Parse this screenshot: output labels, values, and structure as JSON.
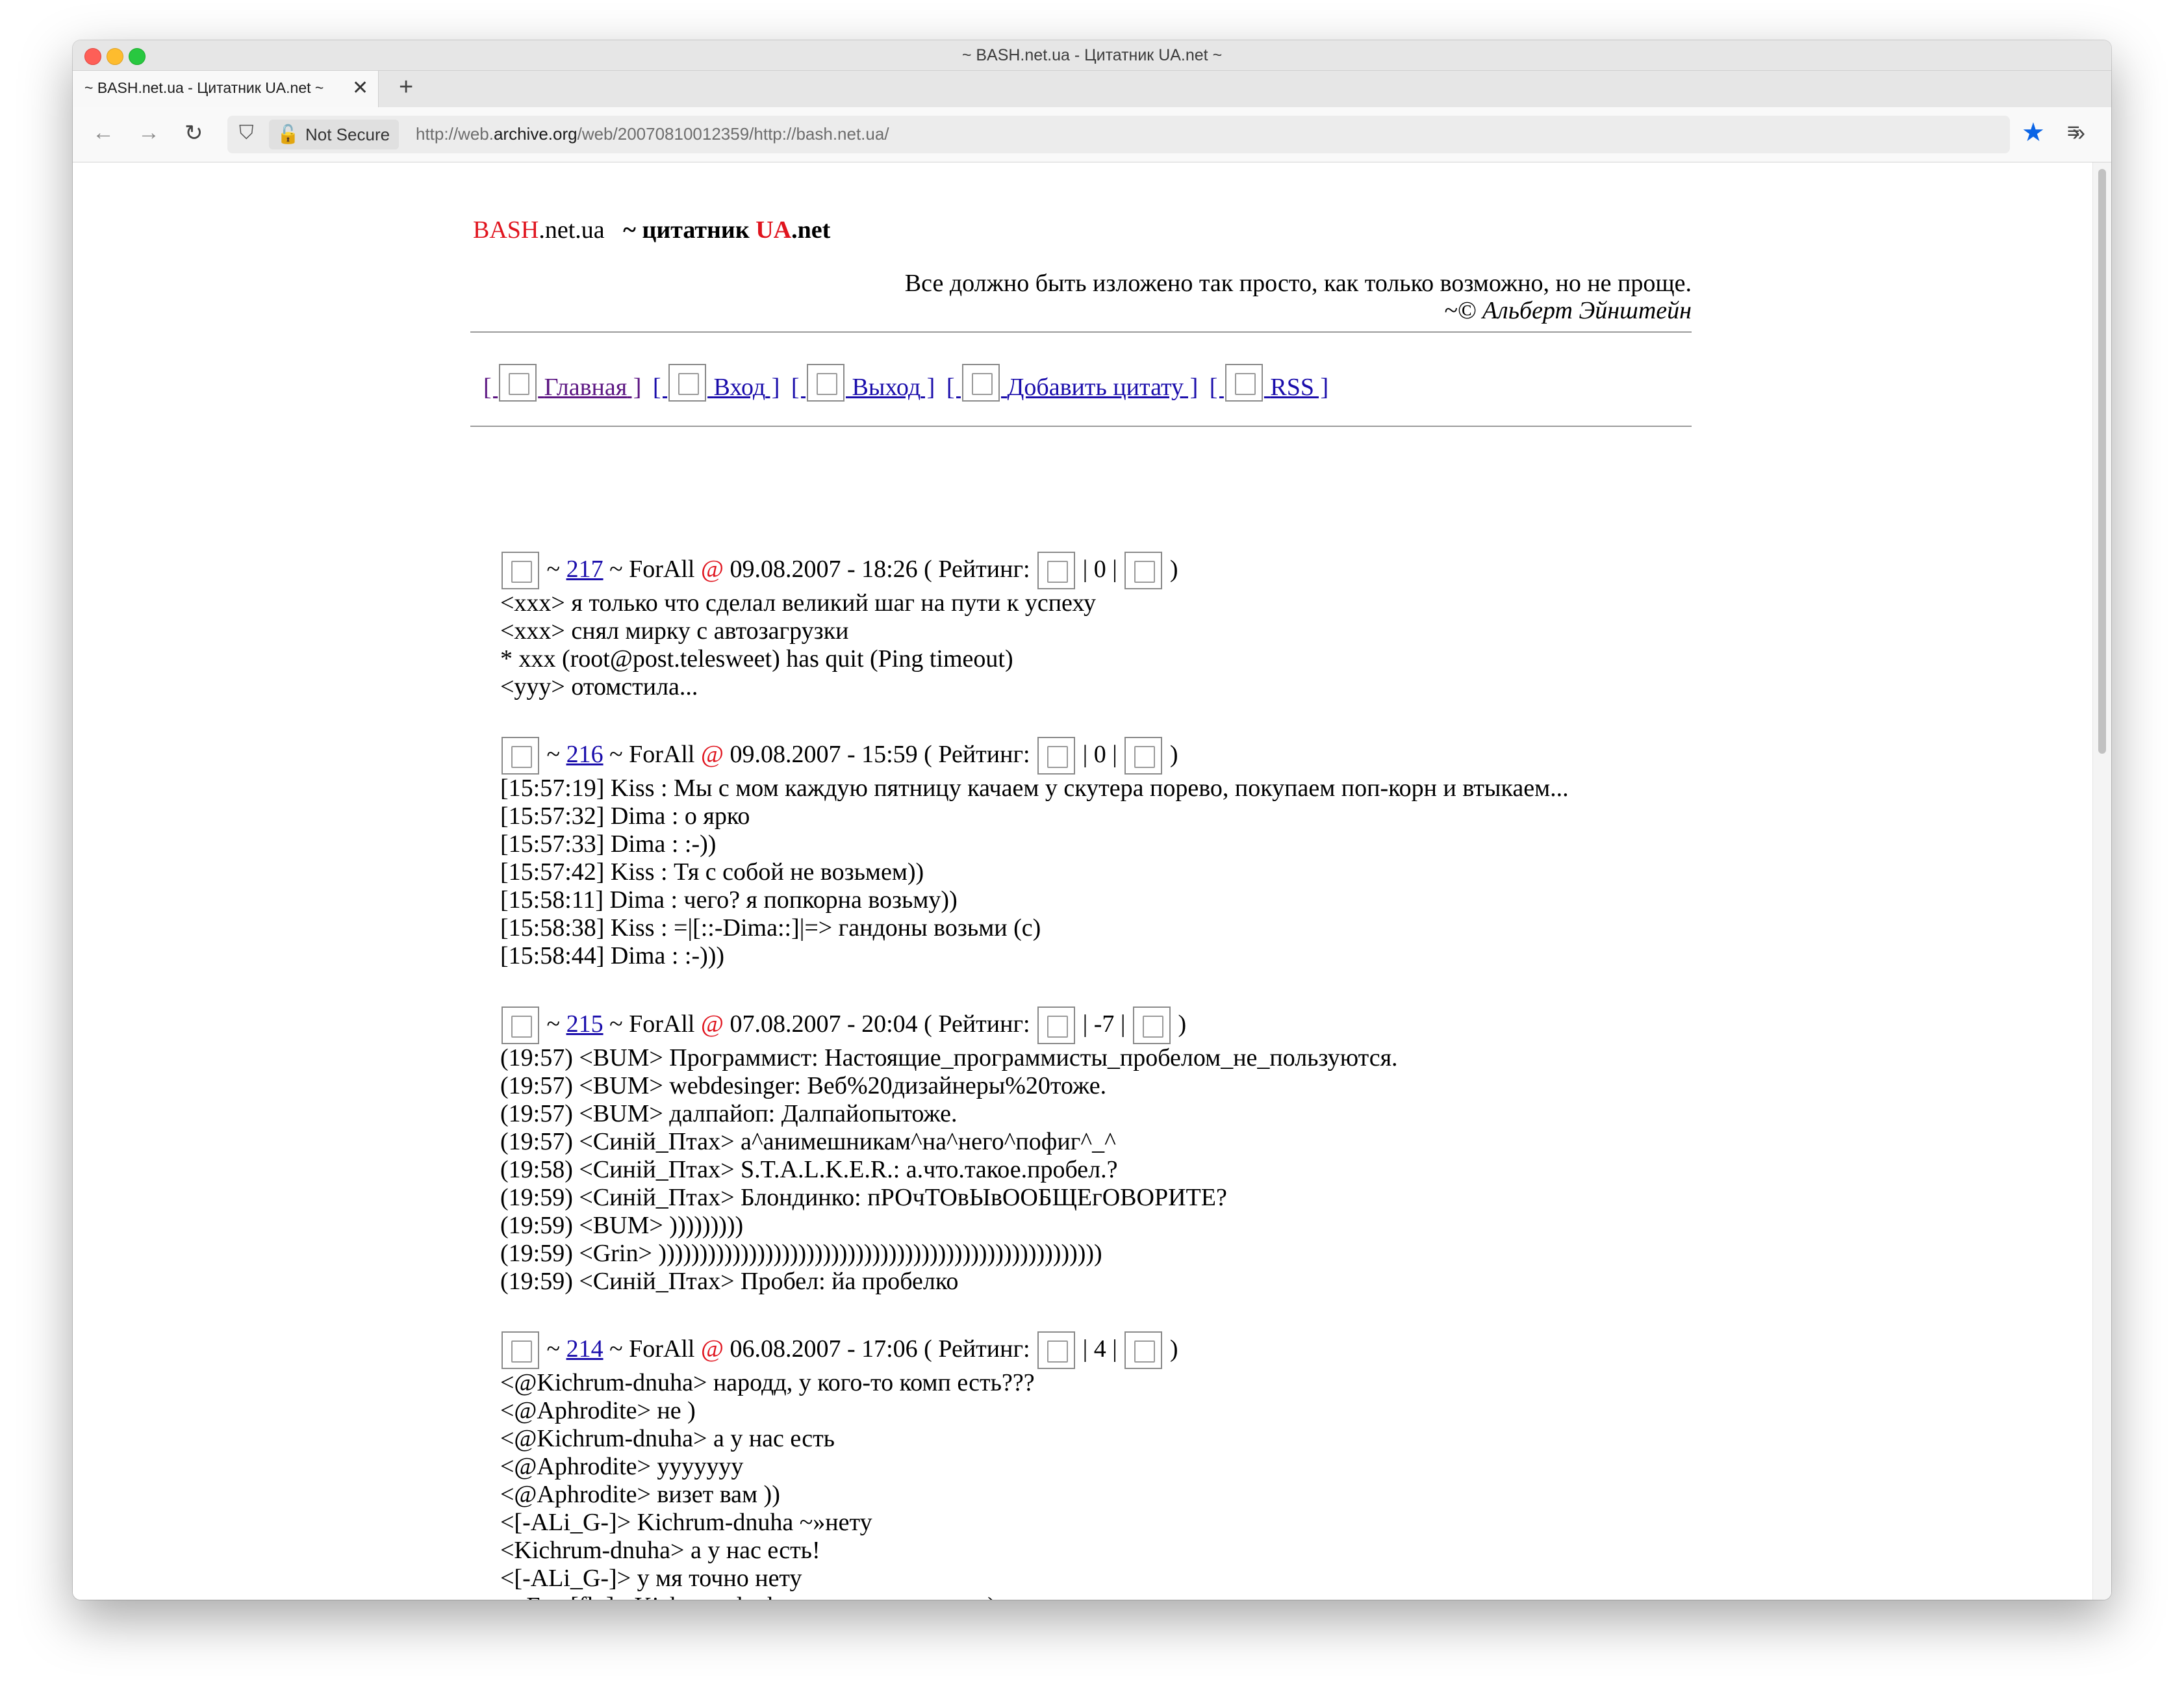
{
  "window": {
    "title": "~ BASH.net.ua - Цитатник UA.net ~"
  },
  "tab": {
    "title": "~ BASH.net.ua - Цитатник UA.net ~",
    "close": "✕",
    "new_tab": "+"
  },
  "toolbar": {
    "back": "←",
    "forward": "→",
    "reload": "↻",
    "not_secure": "Not Secure",
    "url_prefix": "http://web.",
    "url_domain": "archive.org",
    "url_suffix": "/web/20070810012359/http://bash.net.ua/",
    "bookmark_icon": "star-filled-icon",
    "overflow": "»",
    "menu": "≡"
  },
  "site": {
    "logo_red": "BASH",
    "logo_rest": ".net.ua",
    "tilde": "~",
    "tagline_prefix": "цитатник",
    "tagline_red": "UA",
    "tagline_suffix": ".net",
    "quote_line1": "Все должно быть изложено так просто, как только возможно, но не проще.",
    "quote_line2": "~© Альберт Эйнштейн",
    "nav": [
      "Главная",
      "Вход",
      "Выход",
      "Добавить цитату",
      "RSS"
    ]
  },
  "posts": [
    {
      "id": "217",
      "author": "ForAll",
      "at": "@",
      "date": "09.08.2007 - 18:26",
      "rating_label": "Рейтинг:",
      "rating": "0",
      "lines": [
        "<xxx> я только что сделал великий шаг на пути к успеху",
        "<xxx> снял мирку с автозагрузки",
        "* xxx (root@post.telesweet) has quit (Ping timeout)",
        "<yyy> отомстила..."
      ]
    },
    {
      "id": "216",
      "author": "ForAll",
      "at": "@",
      "date": "09.08.2007 - 15:59",
      "rating_label": "Рейтинг:",
      "rating": "0",
      "lines": [
        "[15:57:19] Kiss : Мы с мом каждую пятницу качаем у скутера порево, покупаем поп-корн и втыкаем...",
        "[15:57:32] Dima : о ярко",
        "[15:57:33] Dima : :-))",
        "[15:57:42] Kiss : Тя с собой не возьмем))",
        "[15:58:11] Dima : чего? я попкорна возьму))",
        "[15:58:38] Kiss : =|[::-Dima::]|=> гандоны возьми (с)",
        "[15:58:44] Dima : :-)))"
      ]
    },
    {
      "id": "215",
      "author": "ForAll",
      "at": "@",
      "date": "07.08.2007 - 20:04",
      "rating_label": "Рейтинг:",
      "rating": "-7",
      "lines": [
        "(19:57) <BUM> Программист: Настоящие_программисты_пробелом_не_пользуются.",
        "(19:57) <BUM> webdesinger: Веб%20дизайнеры%20тоже.",
        "(19:57) <BUM> далпайоп: Далпайопытоже.",
        "(19:57) <Синій_Птах> а^анимешникам^на^него^пофиг^_^",
        "(19:58) <Синій_Птах> S.T.A.L.K.E.R.: а.что.такое.пробел.?",
        "(19:59) <Синій_Птах> Блондинко: пРОчТОвЫвООБЩЕгОВОРИТЕ?",
        "(19:59) <BUM> )))))))))",
        "(19:59) <Grin> ))))))))))))))))))))))))))))))))))))))))))))))))))))))",
        "(19:59) <Синій_Птах> Пробел: йа пробелко"
      ]
    },
    {
      "id": "214",
      "author": "ForAll",
      "at": "@",
      "date": "06.08.2007 - 17:06",
      "rating_label": "Рейтинг:",
      "rating": "4",
      "lines": [
        "<@Kichrum-dnuha> народд, у кого-то комп есть???",
        "<@Aphrodite> не )",
        "<@Kichrum-dnuha> а у нас есть",
        "<@Aphrodite> ууууууу",
        "<@Aphrodite> визет вам ))",
        "<[-ALi_G-]> Kichrum-dnuha ~»нету",
        "<Kichrum-dnuha> а у нас есть!",
        "<[-ALi_G-]> у мя точно нету",
        "<_Free[fly]> Kichrum-dnuha, только у вас есть:)"
      ]
    }
  ]
}
